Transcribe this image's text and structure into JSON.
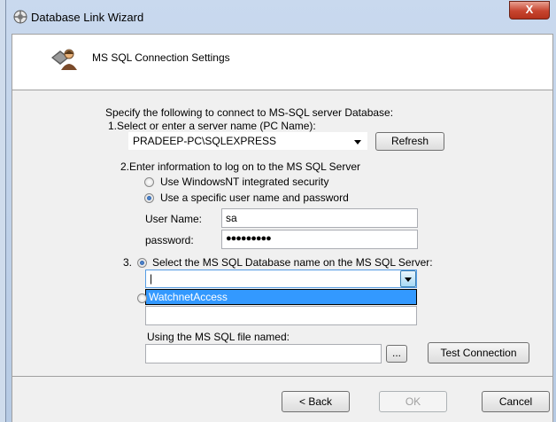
{
  "window": {
    "title": "Database Link Wizard",
    "close_label": "X"
  },
  "header": {
    "title": "MS SQL Connection Settings"
  },
  "main": {
    "intro": "Specify the following to connect to MS-SQL server Database:",
    "step1_label": "1.Select or enter a server name (PC Name):",
    "server_value": "PRADEEP-PC\\SQLEXPRESS",
    "refresh_label": "Refresh",
    "step2_label": "2.Enter information to log on to the MS SQL Server",
    "auth_windows_label": "Use WindowsNT integrated security",
    "auth_specific_label": "Use a specific user name and password",
    "auth_selected": "specific",
    "username_label": "User Name:",
    "username_value": "sa",
    "password_label": "password:",
    "password_value": "●●●●●●●●●",
    "step3_number": "3.",
    "step3_label": "Select the MS SQL Database name on the MS SQL Server:",
    "database_value": "|",
    "database_options": [
      "WatchnetAccess"
    ],
    "file_label": "Using the MS SQL file named:",
    "file_value": "",
    "browse_label": "...",
    "test_connection_label": "Test Connection"
  },
  "footer": {
    "back_label": "< Back",
    "ok_label": "OK",
    "cancel_label": "Cancel"
  },
  "colors": {
    "highlight": "#3399ff",
    "close_button": "#c7442f"
  }
}
